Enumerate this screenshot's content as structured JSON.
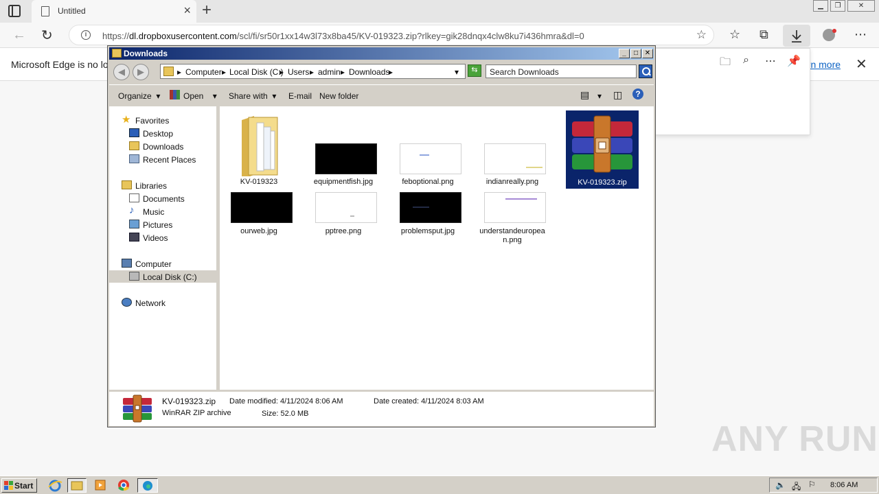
{
  "browser": {
    "tab_title": "Untitled",
    "url_prefix": "https://",
    "url_host": "dl.dropboxusercontent.com",
    "url_path": "/scl/fi/sr50r1xx14w3l73x8ba45/KV-019323.zip?rlkey=gik28dnqx4clw8ku7i436hmra&dl=0",
    "infobar_text": "Microsoft Edge is no lon",
    "infobar_link": "arn more"
  },
  "explorer": {
    "title": "Downloads",
    "breadcrumb": [
      "Computer",
      "Local Disk (C:)",
      "Users",
      "admin",
      "Downloads"
    ],
    "search_placeholder": "Search Downloads",
    "commands": {
      "organize": "Organize",
      "open": "Open",
      "share_with": "Share with",
      "email": "E-mail",
      "new_folder": "New folder"
    },
    "nav": {
      "favorites": "Favorites",
      "desktop": "Desktop",
      "downloads": "Downloads",
      "recent_places": "Recent Places",
      "libraries": "Libraries",
      "documents": "Documents",
      "music": "Music",
      "pictures": "Pictures",
      "videos": "Videos",
      "computer": "Computer",
      "local_disk": "Local Disk (C:)",
      "network": "Network"
    },
    "files": [
      {
        "name": "KV-019323",
        "type": "folder"
      },
      {
        "name": "equipmentfish.jpg",
        "type": "black"
      },
      {
        "name": "feboptional.png",
        "type": "white"
      },
      {
        "name": "indianreally.png",
        "type": "white"
      },
      {
        "name": "KV-019323.zip",
        "type": "winrar",
        "selected": true
      },
      {
        "name": "ourweb.jpg",
        "type": "black"
      },
      {
        "name": "pptree.png",
        "type": "white"
      },
      {
        "name": "problemsput.jpg",
        "type": "black"
      },
      {
        "name": "understandeuropea\nn.png",
        "type": "white"
      }
    ],
    "details": {
      "name": "KV-019323.zip",
      "type_label": "WinRAR ZIP archive",
      "modified": "Date modified: 4/11/2024 8:06 AM",
      "created": "Date created: 4/11/2024 8:03 AM",
      "size": "Size: 52.0 MB"
    }
  },
  "taskbar": {
    "start_label": "Start",
    "clock": "8:06 AM"
  },
  "watermark": "ANY RUN",
  "colors": {
    "titlebar_start": "#0a246a",
    "titlebar_end": "#a6caf0",
    "selection": "#0a246a",
    "link": "#0b62c4"
  }
}
